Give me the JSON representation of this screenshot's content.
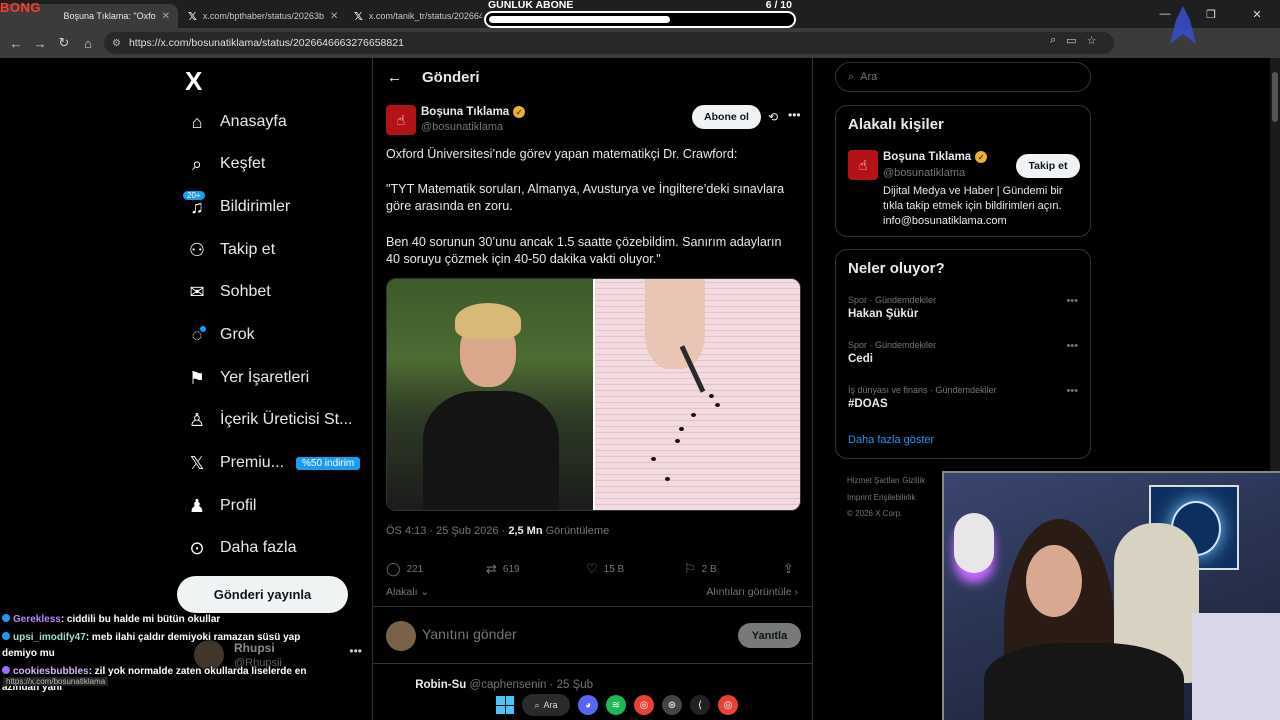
{
  "browser": {
    "tabs": [
      {
        "label": "Boşuna Tıklama: \"Oxfo",
        "active": true
      },
      {
        "label": "x.com/bpthaber/status/20263b",
        "active": false
      },
      {
        "label": "x.com/tanik_tr/status/2026648",
        "active": false
      }
    ],
    "url": "https://x.com/bosunatiklama/status/2026646663276658821",
    "stream_logo": "BONG"
  },
  "goal": {
    "title": "GÜNLÜK ABONE",
    "count": "6  / 10",
    "progress_fraction": 0.6
  },
  "sidebar": {
    "logo": "X",
    "items": [
      {
        "label": "Anasayfa",
        "icon": "home-icon"
      },
      {
        "label": "Keşfet",
        "icon": "search-icon"
      },
      {
        "label": "Bildirimler",
        "icon": "bell-icon",
        "badge": "20+"
      },
      {
        "label": "Takip et",
        "icon": "add-user-icon"
      },
      {
        "label": "Sohbet",
        "icon": "mail-icon"
      },
      {
        "label": "Grok",
        "icon": "grok-icon"
      },
      {
        "label": "Yer İşaretleri",
        "icon": "bookmark-icon"
      },
      {
        "label": "İçerik Üreticisi St...",
        "icon": "creator-icon"
      },
      {
        "label": "Premiu...",
        "icon": "x-premium-icon",
        "promo": "%50 indirim"
      },
      {
        "label": "Profil",
        "icon": "person-icon"
      },
      {
        "label": "Daha fazla",
        "icon": "more-circle-icon"
      }
    ],
    "post_button": "Gönderi yayınla",
    "account": {
      "name": "Rhupsi",
      "handle": "@Rhupsii"
    }
  },
  "main": {
    "header_title": "Gönderi",
    "author": {
      "name": "Boşuna Tıklama",
      "handle": "@bosunatiklama"
    },
    "subscribe_button": "Abone ol",
    "text_1": "Oxford Üniversitesi’nde görev yapan matematikçi Dr. Crawford:",
    "text_2": "\"TYT Matematik soruları, Almanya, Avusturya ve İngiltere’deki sınavlara göre arasında en zoru.",
    "text_3": "Ben 40 sorunun 30’unu ancak 1.5 saatte çözebildim. Sanırım adayların 40 soruyu çözmek için 40-50 dakika vakti oluyor.\"",
    "meta_time": "ÖS 4:13 · 25 Şub 2026 · ",
    "meta_views": "2,5 Mn",
    "meta_views_label": " Görüntüleme",
    "actions": {
      "replies": "221",
      "reposts": "619",
      "likes": "15 B",
      "bookmarks": "2 B"
    },
    "relevance": "Alakalı",
    "quotes": "Alıntıları görüntüle",
    "reply_placeholder": "Yanıtını gönder",
    "reply_button": "Yanıtla",
    "next_reply_name": "Robin-Su",
    "next_reply_meta": "@caphensenin · 25 Şub"
  },
  "right": {
    "search_placeholder": "Ara",
    "related_title": "Alakalı kişiler",
    "related_person": {
      "name": "Boşuna Tıklama",
      "handle": "@bosunatiklama",
      "follow_label": "Takip et",
      "bio": "Dijital Medya ve Haber | Gündemi bir tıkla takip etmek için bildirimleri açın. info@bosunatiklama.com"
    },
    "trends_title": "Neler oluyor?",
    "trends": [
      {
        "category": "Spor · Gündemdekiler",
        "name": "Hakan Şükür"
      },
      {
        "category": "Spor · Gündemdekiler",
        "name": "Cedi"
      },
      {
        "category": "İş dünyası ve finans · Gündemdekiler",
        "name": "#DOAS"
      }
    ],
    "show_more": "Daha fazla göster",
    "footer_1": "Hizmet Şartları   Gizlilik",
    "footer_2": "Imprint   Erişilebilirlik",
    "footer_3": "© 2026 X Corp."
  },
  "chat": [
    {
      "user": "Gerekless",
      "text": ": ciddili bu halde mi bütün okullar"
    },
    {
      "user": "upsi_imodify47",
      "text": ": meb ilahi çaldır demiyoki ramazan süsü yap demiyo mu"
    },
    {
      "user": "cookiesbubbles",
      "text": ": zil yok normalde zaten okullarda liselerde en azından yani"
    }
  ],
  "status_url_hint": "https://x.com/bosunatiklama",
  "taskbar": {
    "search_label": "Ara"
  }
}
